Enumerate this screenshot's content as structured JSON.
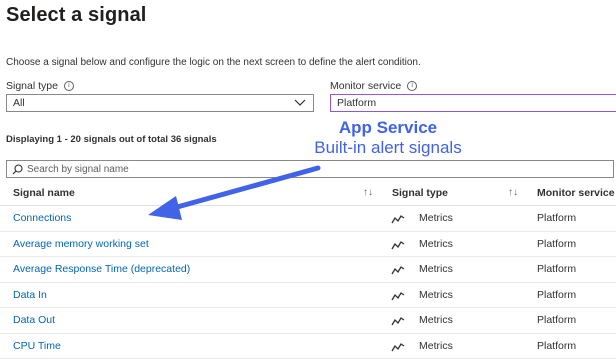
{
  "page": {
    "title": "Select a signal",
    "description": "Choose a signal below and configure the logic on the next screen to define the alert condition."
  },
  "filters": {
    "signal_type_label": "Signal type",
    "signal_type_value": "All",
    "monitor_service_label": "Monitor service",
    "monitor_service_value": "Platform",
    "info_glyph": "i"
  },
  "summary": {
    "count_text": "Displaying 1 - 20 signals out of total 36 signals"
  },
  "search": {
    "placeholder": "Search by signal name"
  },
  "table": {
    "columns": [
      "Signal name",
      "Signal type",
      "Monitor service"
    ],
    "sort_glyph": "↑↓",
    "rows": [
      {
        "name": "Connections",
        "type": "Metrics",
        "service": "Platform"
      },
      {
        "name": "Average memory working set",
        "type": "Metrics",
        "service": "Platform"
      },
      {
        "name": "Average Response Time (deprecated)",
        "type": "Metrics",
        "service": "Platform"
      },
      {
        "name": "Data In",
        "type": "Metrics",
        "service": "Platform"
      },
      {
        "name": "Data Out",
        "type": "Metrics",
        "service": "Platform"
      },
      {
        "name": "CPU Time",
        "type": "Metrics",
        "service": "Platform"
      }
    ]
  },
  "annotation": {
    "line1": "App Service",
    "line2": "Built-in alert signals",
    "color": "#4063e8"
  },
  "colors": {
    "link": "#0066b5",
    "focus_border": "#9a55c9"
  },
  "icons": {
    "info": "info-circle-icon",
    "chevron": "chevron-down-icon",
    "search": "search-icon",
    "metric": "metrics-line-icon",
    "sort": "sort-icon"
  }
}
